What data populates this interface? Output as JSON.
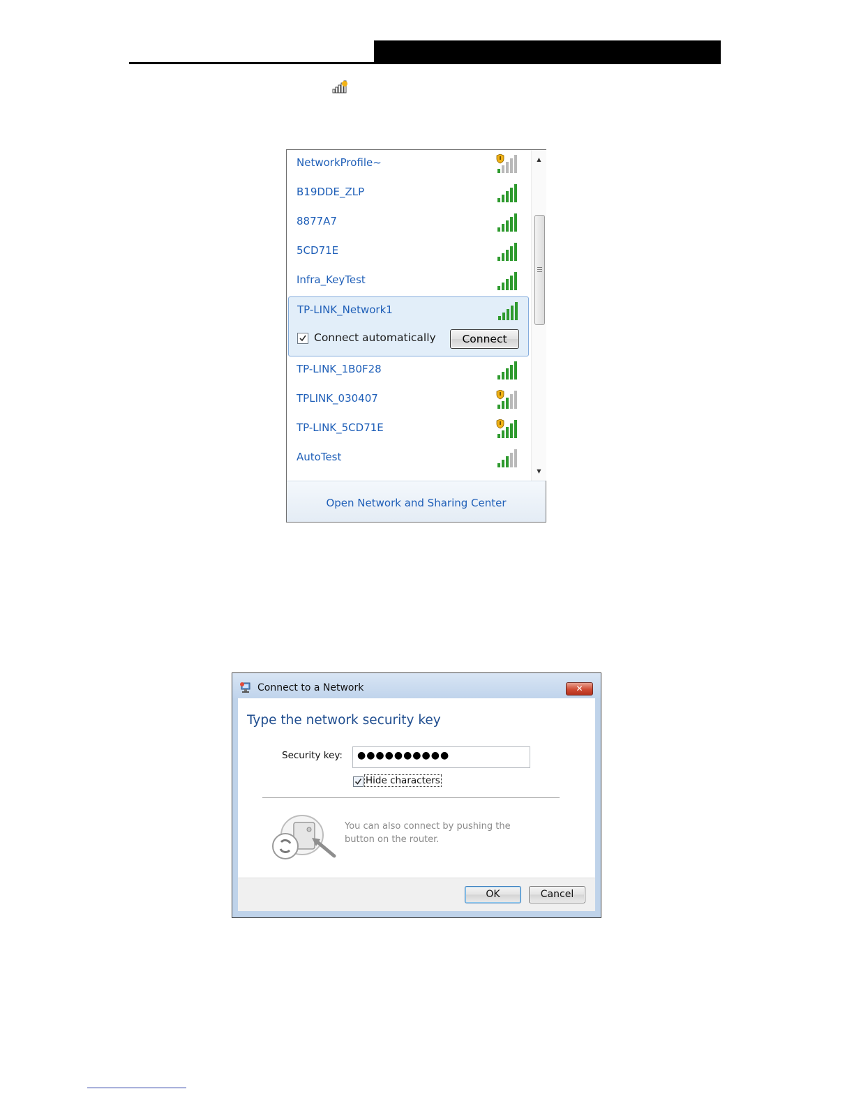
{
  "wlan_panel": {
    "networks": [
      {
        "name": "NetworkProfile~",
        "secured_warning": true,
        "signal_bars": 1
      },
      {
        "name": "B19DDE_ZLP",
        "secured_warning": false,
        "signal_bars": 5
      },
      {
        "name": "8877A7",
        "secured_warning": false,
        "signal_bars": 5
      },
      {
        "name": "5CD71E",
        "secured_warning": false,
        "signal_bars": 5
      },
      {
        "name": "Infra_KeyTest",
        "secured_warning": false,
        "signal_bars": 5
      },
      {
        "name": "TP-LINK_Network1",
        "secured_warning": false,
        "signal_bars": 5,
        "selected": true
      },
      {
        "name": "TP-LINK_1B0F28",
        "secured_warning": false,
        "signal_bars": 5
      },
      {
        "name": "TPLINK_030407",
        "secured_warning": true,
        "signal_bars": 3
      },
      {
        "name": "TP-LINK_5CD71E",
        "secured_warning": true,
        "signal_bars": 5
      },
      {
        "name": "AutoTest",
        "secured_warning": false,
        "signal_bars": 3
      }
    ],
    "selected_network": {
      "connect_automatically_label": "Connect automatically",
      "connect_automatically_checked": true,
      "connect_button_label": "Connect"
    },
    "footer_link": "Open Network and Sharing Center"
  },
  "dialog": {
    "title": "Connect to a Network",
    "heading": "Type the network security key",
    "security_key_label": "Security key:",
    "security_key_value": "●●●●●●●●●●",
    "hide_characters_label": "Hide characters",
    "hide_characters_checked": true,
    "wps_hint": "You can also connect by pushing the button on the router.",
    "ok_label": "OK",
    "cancel_label": "Cancel",
    "close_symbol": "✕"
  },
  "colors": {
    "link_blue": "#1f5fb8",
    "signal_green": "#2e9a2e",
    "signal_gray": "#b9b9b9",
    "warning_yellow": "#f2b317",
    "selection_bg": "#e2eef9"
  },
  "icons": {
    "tray": "wifi-tray-signal-icon",
    "signal": "signal-strength-icon",
    "warning": "security-warning-shield-icon",
    "dialog": "network-connect-icon",
    "wps": "wps-push-button-illustration"
  }
}
